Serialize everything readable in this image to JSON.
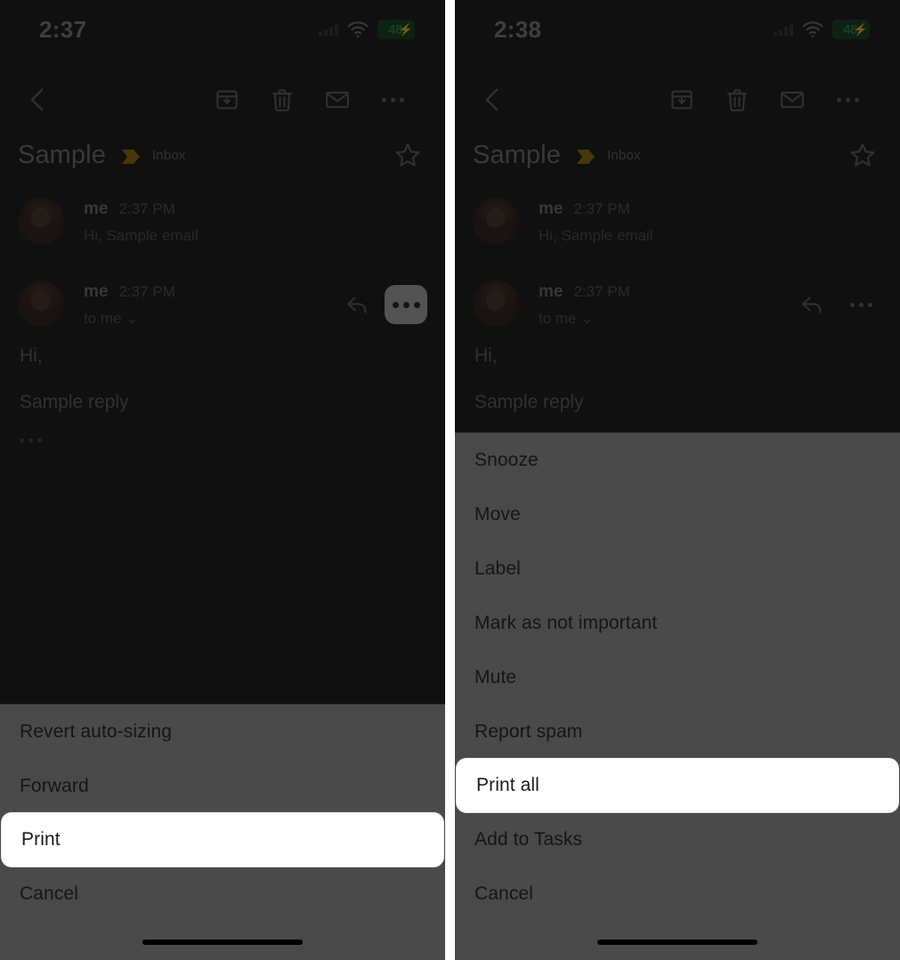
{
  "panels": [
    {
      "id": "left",
      "status": {
        "time": "2:37",
        "battery_level": "48",
        "battery_charging_glyph": "⚡",
        "wifi_icon": "wifi-icon",
        "signal_icon": "signal-bars-icon"
      },
      "toolbar": {
        "back_icon": "back-chevron-icon",
        "archive_icon": "archive-icon",
        "delete_icon": "trash-icon",
        "mark_unread_icon": "envelope-icon",
        "more_icon": "more-options-icon"
      },
      "thread": {
        "subject": "Sample",
        "importance_marker": "importance-marker-icon",
        "label": "Inbox",
        "star_icon": "star-outline-icon",
        "messages": [
          {
            "sender": "me",
            "time": "2:37 PM",
            "snippet": "Hi, Sample email",
            "avatar": "avatar"
          },
          {
            "sender": "me",
            "time": "2:37 PM",
            "snippet": "to me ⌄",
            "avatar": "avatar",
            "reply_icon": "reply-icon",
            "more_icon": "more-options-icon",
            "more_highlighted": true
          }
        ],
        "body_lines": [
          "Hi,",
          "Sample reply"
        ],
        "trimmed_content_icon": "trimmed-content-icon"
      },
      "sheet": {
        "items": [
          {
            "label": "Revert auto-sizing",
            "selected": false
          },
          {
            "label": "Forward",
            "selected": false
          },
          {
            "label": "Print",
            "selected": true
          },
          {
            "label": "Cancel",
            "selected": false
          }
        ]
      }
    },
    {
      "id": "right",
      "status": {
        "time": "2:38",
        "battery_level": "48",
        "battery_charging_glyph": "⚡",
        "wifi_icon": "wifi-icon",
        "signal_icon": "signal-bars-icon"
      },
      "toolbar": {
        "back_icon": "back-chevron-icon",
        "archive_icon": "archive-icon",
        "delete_icon": "trash-icon",
        "mark_unread_icon": "envelope-icon",
        "more_icon": "more-options-icon"
      },
      "thread": {
        "subject": "Sample",
        "importance_marker": "importance-marker-icon",
        "label": "Inbox",
        "star_icon": "star-outline-icon",
        "messages": [
          {
            "sender": "me",
            "time": "2:37 PM",
            "snippet": "Hi, Sample email",
            "avatar": "avatar"
          },
          {
            "sender": "me",
            "time": "2:37 PM",
            "snippet": "to me ⌄",
            "avatar": "avatar",
            "reply_icon": "reply-icon",
            "more_icon": "more-options-icon",
            "more_highlighted": false
          }
        ],
        "body_lines": [
          "Hi,",
          "Sample reply"
        ],
        "trimmed_content_icon": "trimmed-content-icon"
      },
      "sheet": {
        "items": [
          {
            "label": "Snooze",
            "selected": false
          },
          {
            "label": "Move",
            "selected": false
          },
          {
            "label": "Label",
            "selected": false
          },
          {
            "label": "Mark as not important",
            "selected": false
          },
          {
            "label": "Mute",
            "selected": false
          },
          {
            "label": "Report spam",
            "selected": false
          },
          {
            "label": "Print all",
            "selected": true
          },
          {
            "label": "Add to Tasks",
            "selected": false
          },
          {
            "label": "Cancel",
            "selected": false
          }
        ]
      }
    }
  ],
  "colors": {
    "screen_background": "#242424",
    "sheet_background": "#4a4a4a",
    "selected_row": "#ffffff",
    "importance_marker": "#a07a16",
    "battery_green": "#3f8d50",
    "gutter": "#ffffff"
  }
}
